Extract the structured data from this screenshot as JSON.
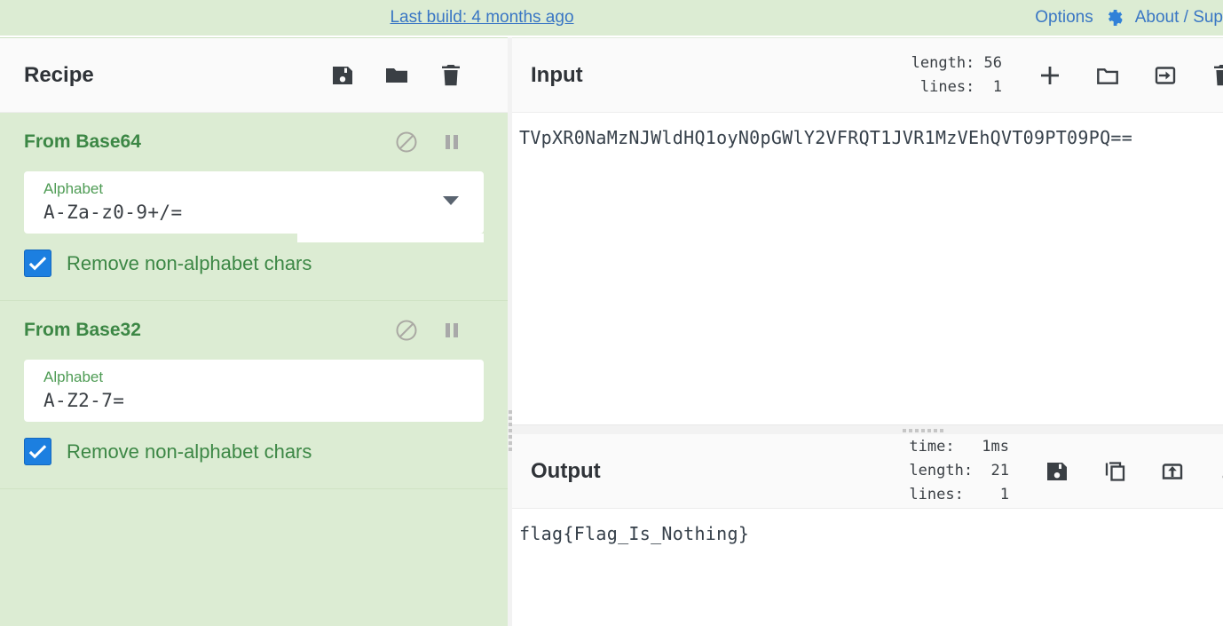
{
  "banner": {
    "build_text": "Last build: 4 months ago",
    "options_label": "Options",
    "options_icon": "gear-icon",
    "about_label": "About / Sup",
    "link_color": "#3976c4",
    "background": "#dcecd3"
  },
  "recipe": {
    "title": "Recipe",
    "header_icons": [
      "save-icon",
      "folder-icon",
      "trash-icon"
    ],
    "accent_color": "#3c8745",
    "background": "#dcecd3",
    "operations": [
      {
        "name": "From Base64",
        "controls": [
          "disable-icon",
          "pause-icon"
        ],
        "arg": {
          "label": "Alphabet",
          "value": "A-Za-z0-9+/=",
          "has_dropdown": true
        },
        "checkbox": {
          "label": "Remove non-alphabet chars",
          "checked": true
        }
      },
      {
        "name": "From Base32",
        "controls": [
          "disable-icon",
          "pause-icon"
        ],
        "arg": {
          "label": "Alphabet",
          "value": "A-Z2-7=",
          "has_dropdown": false
        },
        "checkbox": {
          "label": "Remove non-alphabet chars",
          "checked": true
        }
      }
    ]
  },
  "input": {
    "title": "Input",
    "meta": "length: 56\nlines:  1",
    "length": 56,
    "lines": 1,
    "value": "TVpXR0NaMzNJWldHQ1oyN0pGWlY2VFRQT1JVR1MzVEhQVT09PT09PQ==",
    "icons": [
      "add-icon",
      "folder-open-icon",
      "open-in-icon",
      "trash-icon"
    ]
  },
  "output": {
    "title": "Output",
    "meta": "time:   1ms\nlength:  21\nlines:    1",
    "time": "1ms",
    "length": 21,
    "lines": 1,
    "value": "flag{Flag_Is_Nothing}",
    "icons": [
      "save-icon",
      "copy-icon",
      "replace-input-icon",
      "collapse-icon"
    ]
  }
}
